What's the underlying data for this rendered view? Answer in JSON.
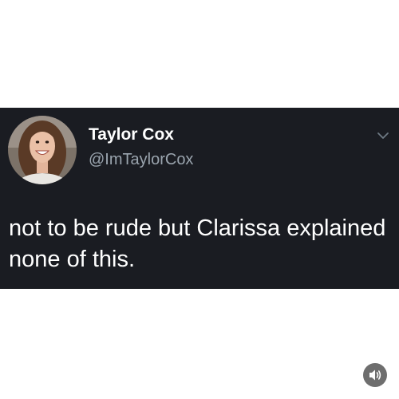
{
  "tweet": {
    "display_name": "Taylor Cox",
    "handle": "@ImTaylorCox",
    "text": "not to be rude but Clarissa explained none of this."
  },
  "icons": {
    "caret": "chevron-down-icon",
    "audio": "speaker-icon"
  },
  "colors": {
    "card_background": "#1a1c22",
    "page_background": "#ffffff",
    "name": "#ffffff",
    "handle": "#9aa4ae",
    "audio_button": "#6e6e6e"
  }
}
